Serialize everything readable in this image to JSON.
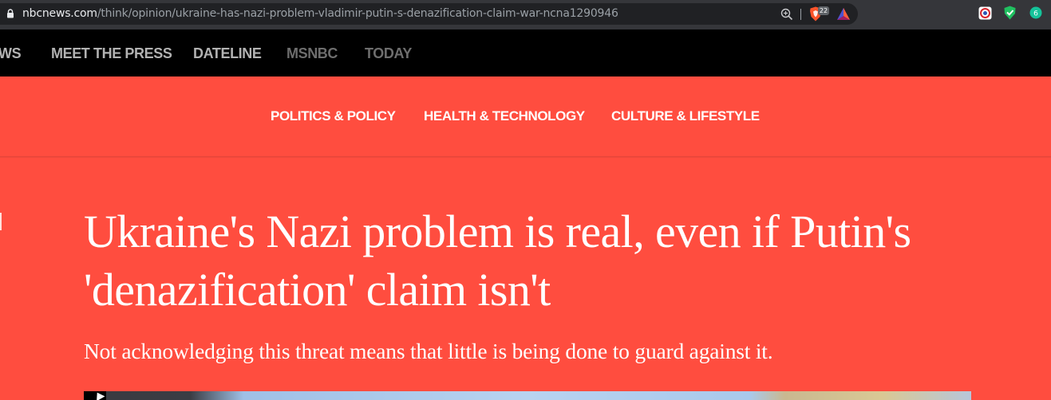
{
  "browser": {
    "url_host": "nbcnews.com",
    "url_path": "/think/opinion/ukraine-has-nazi-problem-vladimir-putin-s-denazification-claim-war-ncna1290946",
    "brave_shields_count": "22",
    "icons": [
      "lock-icon",
      "zoom-icon",
      "brave-shields-icon",
      "brave-rewards-icon",
      "extension-icon",
      "shield-extension-icon",
      "grammar-extension-icon"
    ],
    "extension3_label": "6"
  },
  "topnav": {
    "items": [
      "WS",
      "MEET THE PRESS",
      "DATELINE",
      "MSNBC",
      "TODAY"
    ]
  },
  "subnav": {
    "items": [
      "POLITICS & POLICY",
      "HEALTH & TECHNOLOGY",
      "CULTURE & LIFESTYLE"
    ]
  },
  "article": {
    "headline_line1": "Ukraine's Nazi problem is real, even if Putin's",
    "headline_line2": "'denazification' claim isn't",
    "dek": "Not acknowledging this threat means that little is being done to guard against it."
  },
  "colors": {
    "accent": "#ff4d3f",
    "nav_bg": "#000000",
    "chrome_bg": "#35363a"
  }
}
